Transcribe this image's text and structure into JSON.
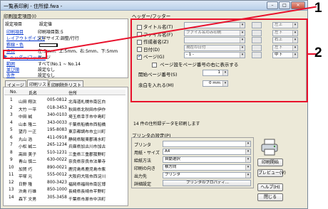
{
  "window": {
    "title": "一覧表印刷 - 住所録.fwa -"
  },
  "print_settings": {
    "group_label": "印刷設定項目(I)",
    "col_item": "設定項目",
    "col_value": "設定値",
    "rows": [
      {
        "key": "印刷項目",
        "value": "印刷項目数:5"
      },
      {
        "key": "レイアウトポイント",
        "value": "文字サイズ:調整/行行"
      },
      {
        "key": "罫線・色",
        "value": ""
      },
      {
        "key": "余白",
        "value": "左:5mm、上:5mm、右:5mm、下:5mm"
      },
      {
        "key": "ヘッダー/フッター",
        "value": "ページ"
      },
      {
        "key": "範囲",
        "value": "すべて(No.1 ~ No.14"
      },
      {
        "key": "並び順",
        "value": "設定なし"
      },
      {
        "key": "条件",
        "value": "設定なし"
      }
    ],
    "selected_key": "ヘッダー/フッター"
  },
  "tabs": {
    "image": "イメージ",
    "list": "印刷リスト",
    "nonprint": "印刷除外リスト"
  },
  "list": {
    "headers": {
      "no": "No.",
      "name": "氏名",
      "address": "住所"
    },
    "rows": [
      {
        "no": "1",
        "name": "山田 翔汰",
        "zip": "005-0812",
        "addr": "北海道札幌市南区白"
      },
      {
        "no": "2",
        "name": "大竹 一平",
        "zip": "018-3453",
        "addr": "秋田県北秋田市伊作"
      },
      {
        "no": "3",
        "name": "中田 誠",
        "zip": "340-0103",
        "addr": "埼玉県幸手市中島町"
      },
      {
        "no": "4",
        "name": "山本 隆二",
        "zip": "343-0033",
        "addr": "千葉県船橋市西船橋"
      },
      {
        "no": "5",
        "name": "望月 一正",
        "zip": "195-8083",
        "addr": "東京都調布市立川町"
      },
      {
        "no": "6",
        "name": "丸山 浩",
        "zip": "411-0918",
        "addr": "静岡県駿東郡清水町"
      },
      {
        "no": "7",
        "name": "小松 誠二",
        "zip": "265-1234",
        "addr": "兵庫県加古川市加古"
      },
      {
        "no": "8",
        "name": "高田 美子",
        "zip": "510-1231",
        "addr": "三重県三重郡菰野町"
      },
      {
        "no": "9",
        "name": "青山 慎二",
        "zip": "630-0022",
        "addr": "奈良県奈良市法華寺"
      },
      {
        "no": "10",
        "name": "加賀 巧",
        "zip": "890-0021",
        "addr": "鹿児島県鹿児島市紫"
      },
      {
        "no": "11",
        "name": "平塚 元",
        "zip": "555-0012",
        "addr": "大阪府大阪市西淀川"
      },
      {
        "no": "12",
        "name": "日野 隆",
        "zip": "800-3423",
        "addr": "福岡県福岡市南区博"
      },
      {
        "no": "13",
        "name": "渋島 行雄",
        "zip": "850-1000",
        "addr": "長崎県長崎市平野町"
      },
      {
        "no": "14",
        "name": "森下 文男",
        "zip": "305-3458",
        "addr": "千葉県市原市中浜町"
      }
    ]
  },
  "header_footer": {
    "group_label": "ヘッダー/フッター",
    "items": [
      {
        "label": "タイトル名(T)",
        "checked": false,
        "combo": "",
        "pos": "左上"
      },
      {
        "label": "ファイル名(F)",
        "checked": false,
        "combo": "ファイル名のみ印刷",
        "pos": "左下"
      },
      {
        "label": "作成者名(Z)",
        "checked": false,
        "combo": "",
        "pos": "右上"
      },
      {
        "label": "日付(D)",
        "checked": false,
        "combo": "現在の日付",
        "pos": "左下"
      },
      {
        "label": "ページ(G)",
        "checked": true,
        "combo": "- 1 -",
        "pos": "中下"
      }
    ],
    "page_hint": "ページ設をページ番号の右に表示する",
    "start_page_label": "開始ページ番号(S)",
    "start_page_value": "1",
    "margin_label": "余白を入れる(M)",
    "margin_value": "0 mm"
  },
  "status_text": "14 件の住所録データを印刷します",
  "printer": {
    "group_label": "プリンタの設定(P)",
    "rows": [
      {
        "label": "プリンタ",
        "value": ""
      },
      {
        "label": "用紙・サイズ",
        "value": "A4"
      },
      {
        "label": "給紙方法",
        "value": "自動選択"
      },
      {
        "label": "印刷の向き",
        "value": "横方向"
      },
      {
        "label": "出力先",
        "value": "プリンタ"
      },
      {
        "label": "詳細設定",
        "value": "プリンタのプロパティ..."
      }
    ]
  },
  "buttons": {
    "print": "印刷開始",
    "preview": "プレビュー(V)",
    "help": "ヘルプ(H)",
    "close": "閉じる"
  },
  "callouts": {
    "one": "1",
    "two": "2"
  },
  "colors": {
    "callout_red": "#e8102b",
    "link_blue": "#0033cc"
  },
  "icons": {
    "printer": "printer-icon",
    "selected_arrow": "triangle-right-icon"
  }
}
